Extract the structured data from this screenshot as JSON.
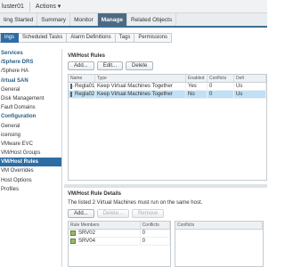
{
  "titlebar": {
    "title": "luster01",
    "actions_label": "Actions ▾"
  },
  "top_tabs": [
    {
      "label": "ting Started",
      "active": false
    },
    {
      "label": "Summary",
      "active": false
    },
    {
      "label": "Monitor",
      "active": false
    },
    {
      "label": "Manage",
      "active": true
    },
    {
      "label": "Related Objects",
      "active": false
    }
  ],
  "sub_tabs": [
    {
      "label": "ings",
      "active": true
    },
    {
      "label": "Scheduled Tasks",
      "active": false
    },
    {
      "label": "Alarm Definitions",
      "active": false
    },
    {
      "label": "Tags",
      "active": false
    },
    {
      "label": "Permissions",
      "active": false
    }
  ],
  "sidebar": {
    "items": [
      {
        "label": "Services",
        "type": "header"
      },
      {
        "label": "/Sphere DRS",
        "type": "header"
      },
      {
        "label": "/Sphere HA",
        "type": "item"
      },
      {
        "label": "/irtual SAN",
        "type": "header"
      },
      {
        "label": "General",
        "type": "item"
      },
      {
        "label": "Disk Management",
        "type": "item"
      },
      {
        "label": "Fault Domains",
        "type": "item"
      },
      {
        "label": "Configuration",
        "type": "header"
      },
      {
        "label": "General",
        "type": "item"
      },
      {
        "label": "icensing",
        "type": "item"
      },
      {
        "label": "VMware EVC",
        "type": "item"
      },
      {
        "label": "VM/Host Groups",
        "type": "item"
      },
      {
        "label": "VM/Host Rules",
        "type": "selected"
      },
      {
        "label": "VM Overrides",
        "type": "item"
      },
      {
        "label": "Host Options",
        "type": "item"
      },
      {
        "label": "Profiles",
        "type": "item"
      }
    ]
  },
  "rules_panel": {
    "title": "VM/Host Rules",
    "buttons": {
      "add": "Add...",
      "edit": "Edit...",
      "delete": "Delete"
    },
    "columns": [
      "Name",
      "Type",
      "Enabled",
      "Conflicts",
      "Defi"
    ],
    "rows": [
      {
        "name": "Regla01",
        "type": "Keep Virtual Machines Together",
        "enabled": "Yes",
        "conflicts": "0",
        "defined": "Us",
        "selected": false
      },
      {
        "name": "Regla02",
        "type": "Keep Virtual Machines Together",
        "enabled": "No",
        "conflicts": "0",
        "defined": "Us",
        "selected": true
      }
    ]
  },
  "details_panel": {
    "title": "VM/Host Rule Details",
    "description": "The listed 2 Virtual Machines must run on the same host.",
    "buttons": {
      "add": "Add...",
      "delete": "Delete...",
      "remove": "Remove"
    },
    "columns": [
      "Rule Members",
      "Conflicts"
    ],
    "members": [
      {
        "name": "SRV02",
        "conflicts": "0"
      },
      {
        "name": "SRV04",
        "conflicts": "0"
      }
    ],
    "conflicts_header": "Conflicts"
  },
  "colors": {
    "accent": "#2e6da4",
    "selected_row": "#bfe0f5",
    "active_top_tab": "#4e6a82"
  }
}
